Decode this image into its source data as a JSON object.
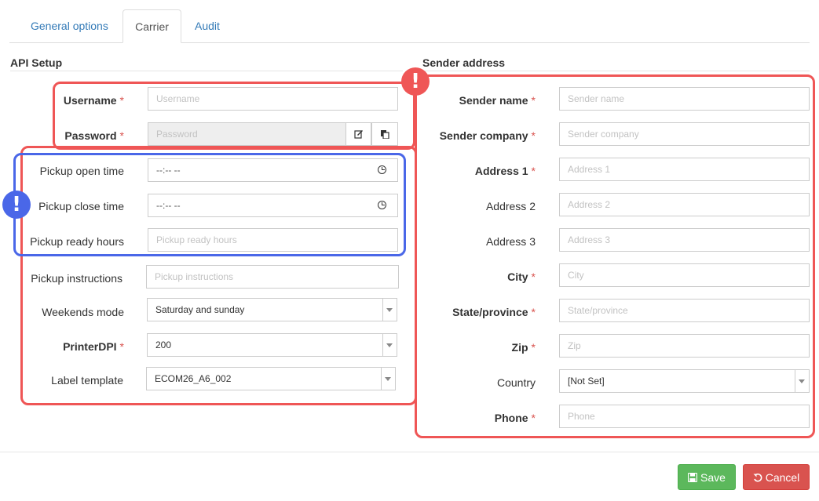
{
  "tabs": [
    {
      "label": "General options"
    },
    {
      "label": "Carrier"
    },
    {
      "label": "Audit"
    }
  ],
  "api_setup": {
    "title": "API Setup",
    "username": {
      "label": "Username",
      "required": "*",
      "placeholder": "Username"
    },
    "password": {
      "label": "Password",
      "required": "*",
      "placeholder": "Password"
    },
    "pickup_open_time": {
      "label": "Pickup open time",
      "value": "--:-- --"
    },
    "pickup_close_time": {
      "label": "Pickup close time",
      "value": "--:-- --"
    },
    "pickup_ready_hours": {
      "label": "Pickup ready hours",
      "placeholder": "Pickup ready hours"
    },
    "pickup_instructions": {
      "label": "Pickup instructions",
      "placeholder": "Pickup instructions"
    },
    "weekends_mode": {
      "label": "Weekends mode",
      "value": "Saturday and sunday"
    },
    "printer_dpi": {
      "label": "PrinterDPI",
      "required": "*",
      "value": "200"
    },
    "label_template": {
      "label": "Label template",
      "value": "ECOM26_A6_002"
    }
  },
  "sender_address": {
    "title": "Sender address",
    "sender_name": {
      "label": "Sender name",
      "required": "*",
      "placeholder": "Sender name"
    },
    "sender_company": {
      "label": "Sender company",
      "required": "*",
      "placeholder": "Sender company"
    },
    "address1": {
      "label": "Address 1",
      "required": "*",
      "placeholder": "Address 1"
    },
    "address2": {
      "label": "Address 2",
      "placeholder": "Address 2"
    },
    "address3": {
      "label": "Address 3",
      "placeholder": "Address 3"
    },
    "city": {
      "label": "City",
      "required": "*",
      "placeholder": "City"
    },
    "state": {
      "label": "State/province",
      "required": "*",
      "placeholder": "State/province"
    },
    "zip": {
      "label": "Zip",
      "required": "*",
      "placeholder": "Zip"
    },
    "country": {
      "label": "Country",
      "value": "[Not Set]"
    },
    "phone": {
      "label": "Phone",
      "required": "*",
      "placeholder": "Phone"
    }
  },
  "badges": {
    "warning": "!",
    "info": "!"
  },
  "footer": {
    "save_label": "Save",
    "cancel_label": "Cancel"
  },
  "colors": {
    "highlight_red": "#ef5656",
    "highlight_blue": "#4a67e8",
    "save": "#5cb85c",
    "cancel": "#d9534f",
    "link": "#337ab7"
  }
}
